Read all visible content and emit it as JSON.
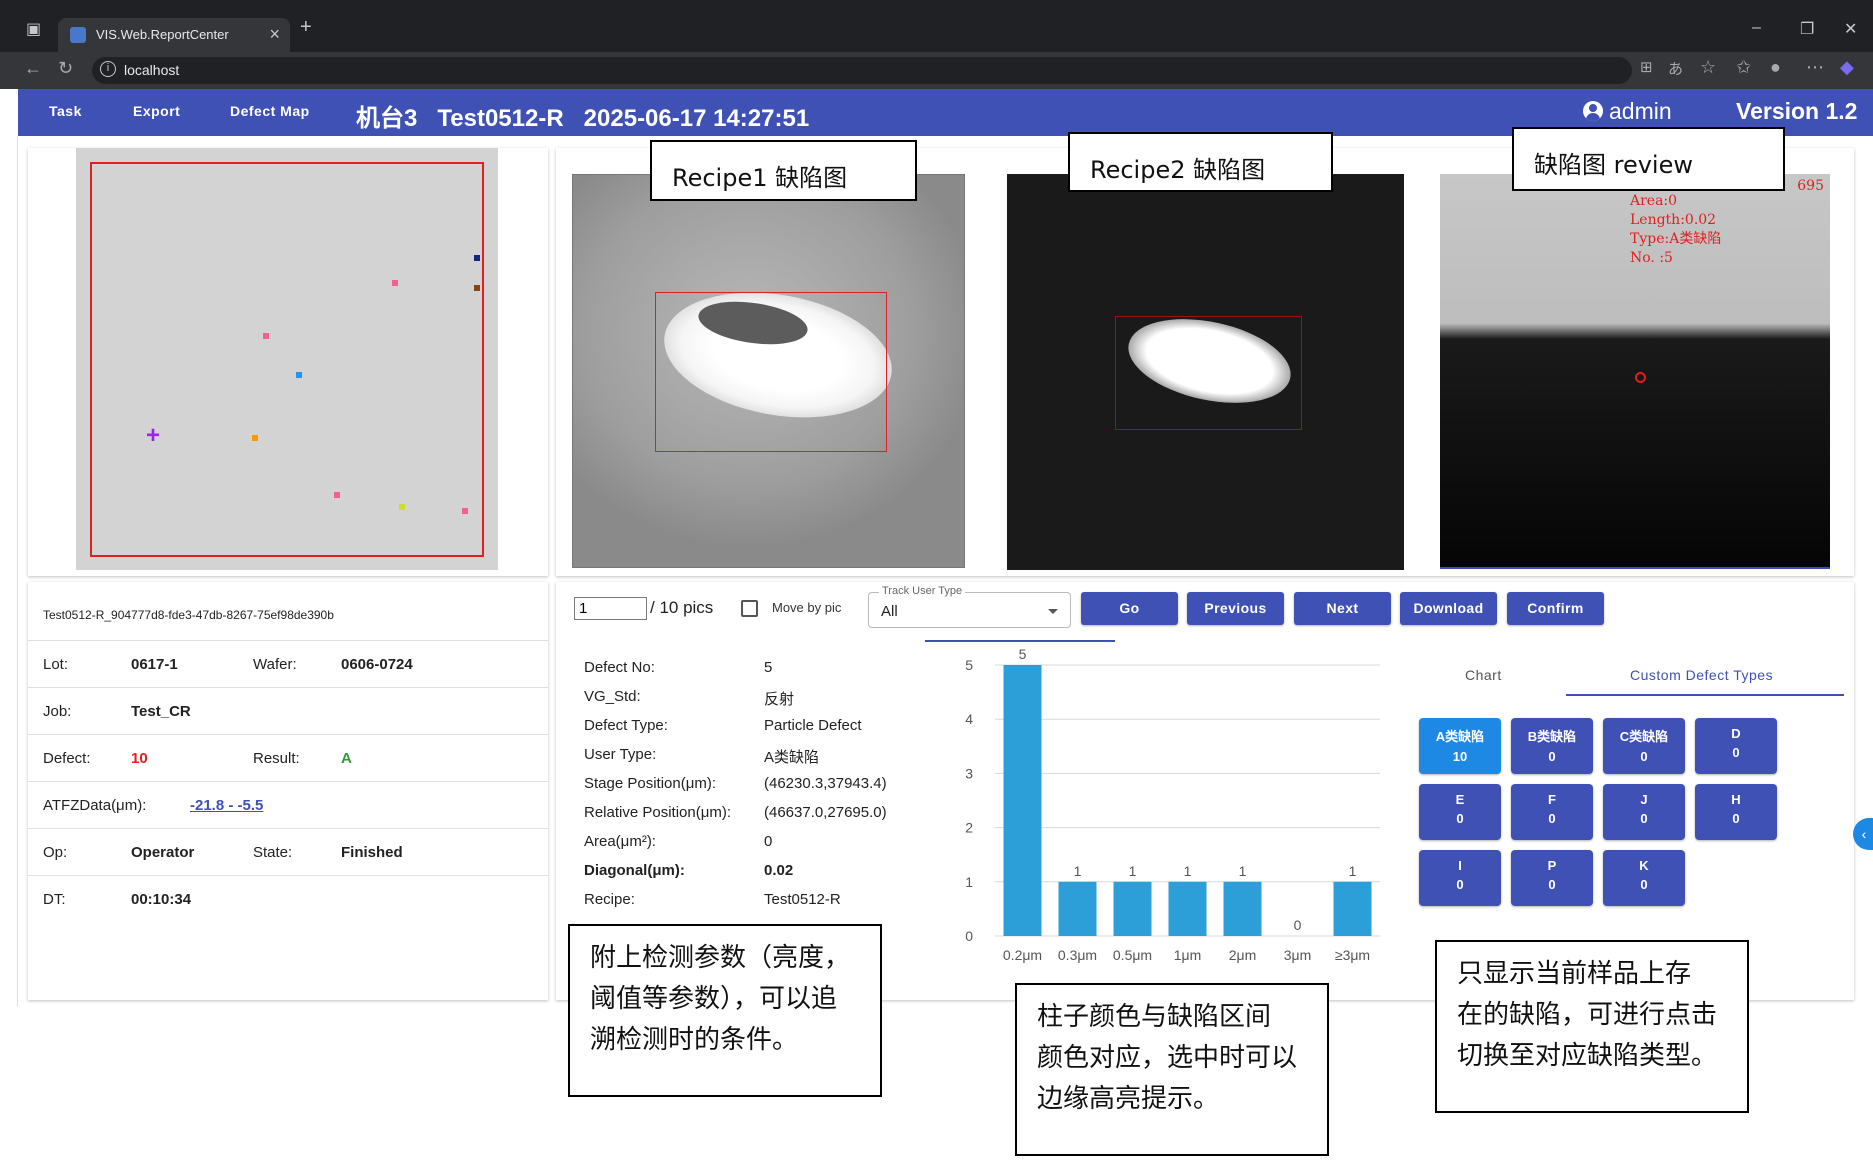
{
  "browser": {
    "tab_title": "VIS.Web.ReportCenter",
    "url": "localhost"
  },
  "header": {
    "nav": [
      "Task",
      "Export",
      "Defect Map"
    ],
    "machine": "机台3",
    "recipe": "Test0512-R",
    "datetime": "2025-06-17 14:27:51",
    "user": "admin",
    "version": "Version 1.2"
  },
  "annotations": {
    "recipe1": "Recipe1 缺陷图",
    "recipe2": "Recipe2 缺陷图",
    "review": "缺陷图 review",
    "params": [
      "附上检测参数（亮度，",
      "阈值等参数），可以追",
      "溯检测时的条件。"
    ],
    "colors": [
      "柱子颜色与缺陷区间",
      "颜色对应，选中时可以",
      "边缘高亮提示。"
    ],
    "types": [
      "只显示当前样品上存",
      "在的缺陷，可进行点击",
      "切换至对应缺陷类型。"
    ]
  },
  "review_overlay": {
    "value": "695",
    "lines": [
      "Area:0",
      "Length:0.02",
      "Type:A类缺陷",
      "No. :5"
    ]
  },
  "info": {
    "file_id": "Test0512-R_904777d8-fde3-47db-8267-75ef98de390b",
    "lot_label": "Lot:",
    "lot": "0617-1",
    "wafer_label": "Wafer:",
    "wafer": "0606-0724",
    "job_label": "Job:",
    "job": "Test_CR",
    "defect_label": "Defect:",
    "defect": "10",
    "result_label": "Result:",
    "result": "A",
    "atfz_label": "ATFZData(μm):",
    "atfz": "-21.8 - -5.5",
    "op_label": "Op:",
    "op": "Operator",
    "state_label": "State:",
    "state": "Finished",
    "dt_label": "DT:",
    "dt": "00:10:34"
  },
  "toolbar": {
    "page_value": "1",
    "pics": "/ 10 pics",
    "move_by_pic": "Move by pic",
    "track_label": "Track User Type",
    "track_value": "All",
    "buttons": [
      "Go",
      "Previous",
      "Next",
      "Download",
      "Confirm"
    ]
  },
  "defect_details": [
    {
      "label": "Defect No:",
      "value": "5"
    },
    {
      "label": "VG_Std:",
      "value": "反射"
    },
    {
      "label": "Defect Type:",
      "value": "Particle Defect"
    },
    {
      "label": "User Type:",
      "value": "A类缺陷"
    },
    {
      "label": "Stage Position(μm):",
      "value": "(46230.3,37943.4)"
    },
    {
      "label": "Relative Position(μm):",
      "value": "(46637.0,27695.0)"
    },
    {
      "label": "Area(μm²):",
      "value": "0"
    },
    {
      "label": "Diagonal(μm):",
      "value": "0.02"
    },
    {
      "label": "Recipe:",
      "value": "Test0512-R"
    }
  ],
  "chart_data": {
    "type": "bar",
    "categories": [
      "0.2μm",
      "0.3μm",
      "0.5μm",
      "1μm",
      "2μm",
      "3μm",
      "≥3μm"
    ],
    "values": [
      5,
      1,
      1,
      1,
      1,
      0,
      1
    ],
    "ylim": [
      0,
      5
    ],
    "yticks": [
      0,
      1,
      2,
      3,
      4,
      5
    ],
    "grid": true,
    "bar_color": "#2c9fd9"
  },
  "type_tabs": [
    "Chart",
    "Custom Defect Types"
  ],
  "defect_types": [
    {
      "name": "A类缺陷",
      "count": "10"
    },
    {
      "name": "B类缺陷",
      "count": "0"
    },
    {
      "name": "C类缺陷",
      "count": "0"
    },
    {
      "name": "D",
      "count": "0"
    },
    {
      "name": "E",
      "count": "0"
    },
    {
      "name": "F",
      "count": "0"
    },
    {
      "name": "J",
      "count": "0"
    },
    {
      "name": "H",
      "count": "0"
    },
    {
      "name": "I",
      "count": "0"
    },
    {
      "name": "P",
      "count": "0"
    },
    {
      "name": "K",
      "count": "0"
    }
  ],
  "colors": {
    "primary": "#3f51b5",
    "selected": "#1e88e5",
    "defect_count": "#e02020",
    "result_ok": "#2e9d3a"
  }
}
